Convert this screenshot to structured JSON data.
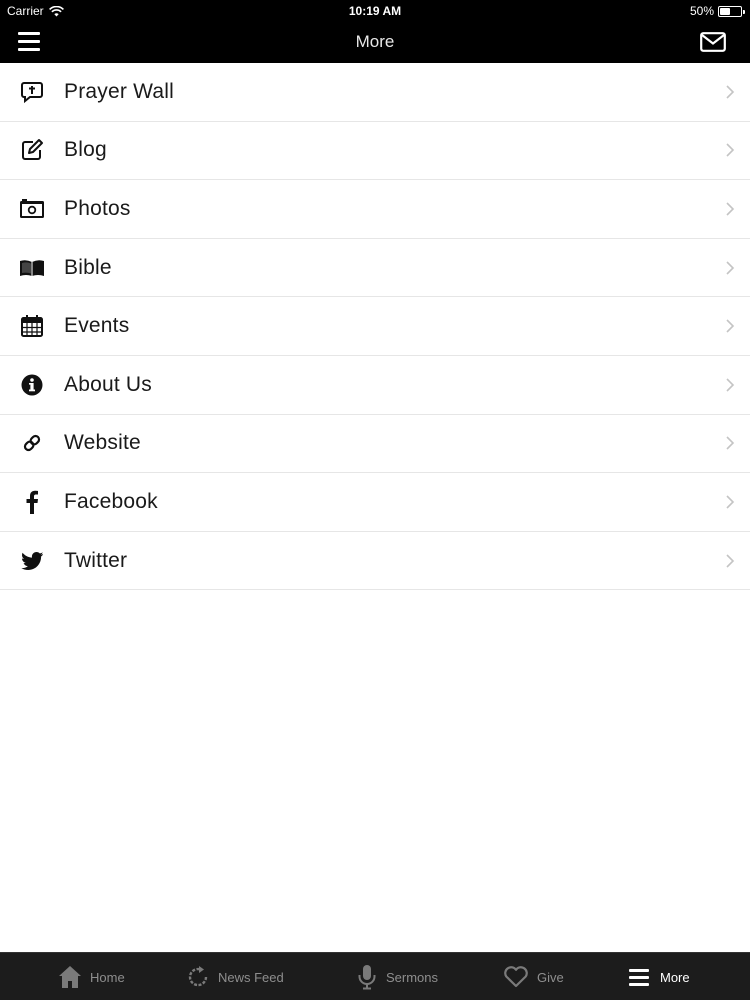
{
  "status_bar": {
    "carrier": "Carrier",
    "time": "10:19 AM",
    "battery": "50%",
    "battery_level": 0.5
  },
  "nav": {
    "title": "More"
  },
  "menu": {
    "items": [
      {
        "label": "Prayer Wall",
        "icon": "prayer-speech-bubble-icon"
      },
      {
        "label": "Blog",
        "icon": "edit-pencil-icon"
      },
      {
        "label": "Photos",
        "icon": "camera-icon"
      },
      {
        "label": "Bible",
        "icon": "open-book-icon"
      },
      {
        "label": "Events",
        "icon": "calendar-icon"
      },
      {
        "label": "About Us",
        "icon": "info-circle-icon"
      },
      {
        "label": "Website",
        "icon": "link-icon"
      },
      {
        "label": "Facebook",
        "icon": "facebook-icon"
      },
      {
        "label": "Twitter",
        "icon": "twitter-icon"
      }
    ]
  },
  "tabs": [
    {
      "label": "Home",
      "icon": "home-icon",
      "active": false
    },
    {
      "label": "News Feed",
      "icon": "refresh-icon",
      "active": false
    },
    {
      "label": "Sermons",
      "icon": "microphone-icon",
      "active": false
    },
    {
      "label": "Give",
      "icon": "heart-icon",
      "active": false
    },
    {
      "label": "More",
      "icon": "hamburger-icon",
      "active": true
    }
  ],
  "colors": {
    "bar_background": "#000000",
    "tab_background": "#1c1c1c",
    "tab_inactive": "#8e8e8e",
    "tab_active": "#ffffff"
  }
}
